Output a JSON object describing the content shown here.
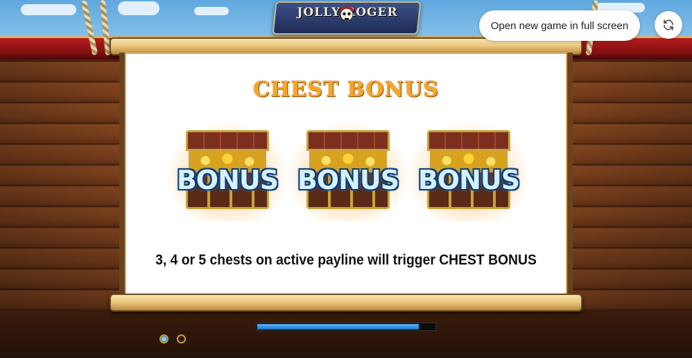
{
  "game": {
    "logo_text": "JOLLY ROGER"
  },
  "panel": {
    "title": "CHEST BONUS",
    "chests": [
      {
        "label": "BONUS"
      },
      {
        "label": "BONUS"
      },
      {
        "label": "BONUS"
      }
    ],
    "description": "3, 4 or 5 chests on active payline will trigger CHEST BONUS"
  },
  "loading": {
    "progress": 0.91
  },
  "pagination": {
    "pages": 2,
    "current": 1
  },
  "overlay": {
    "fullscreen_label": "Open new game in full screen",
    "refresh_icon": "refresh-icon"
  },
  "colors": {
    "title": "#f6a623",
    "bonus_text": "#d6f0ff",
    "progress": "#1b6fc4",
    "rail": "#b81d1d"
  }
}
